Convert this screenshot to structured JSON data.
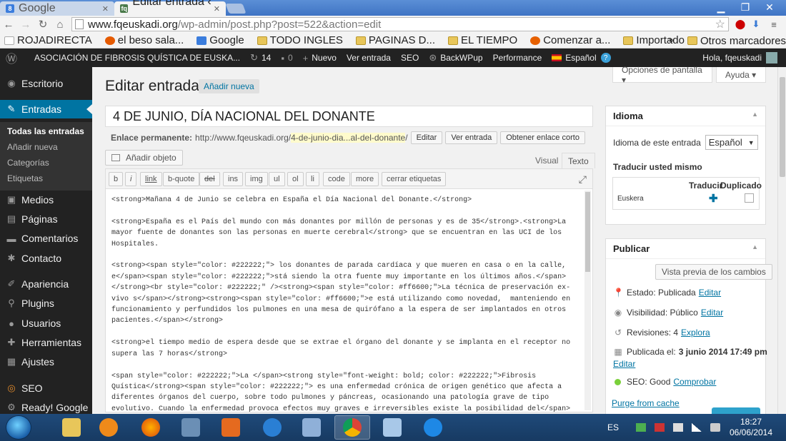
{
  "browser": {
    "tabs": [
      {
        "label": "Google",
        "active": false
      },
      {
        "label": "Editar entrada ‹ .",
        "active": true
      }
    ],
    "url_domain": "www.fqeuskadi.org",
    "url_rest": "/wp-admin/post.php?post=522&action=edit",
    "bookmarks": [
      "ROJADIRECTA",
      "el beso sala...",
      "Google",
      "TODO INGLES",
      "PAGINAS D...",
      "EL TIEMPO",
      "Comenzar a...",
      "Importado ..."
    ],
    "bookmarks_more": "»",
    "other_bookmarks": "Otros marcadores"
  },
  "adminbar": {
    "site_name": "ASOCIACIÓN DE FIBROSIS QUÍSTICA DE EUSKA...",
    "updates_count": "14",
    "comments_count": "0",
    "new_label": "Nuevo",
    "view_post": "Ver entrada",
    "seo": "SEO",
    "backwpup": "BackWPup",
    "performance": "Performance",
    "language": "Español",
    "greeting": "Hola, fqeuskadi"
  },
  "sidebar": {
    "items": [
      {
        "label": "Escritorio",
        "icon": "dashboard-icon"
      },
      {
        "label": "Entradas",
        "icon": "pin-icon"
      },
      {
        "label": "Medios",
        "icon": "media-icon"
      },
      {
        "label": "Páginas",
        "icon": "pages-icon"
      },
      {
        "label": "Comentarios",
        "icon": "comments-icon"
      },
      {
        "label": "Contacto",
        "icon": "contact-icon"
      },
      {
        "label": "Apariencia",
        "icon": "brush-icon"
      },
      {
        "label": "Plugins",
        "icon": "plugin-icon"
      },
      {
        "label": "Usuarios",
        "icon": "users-icon"
      },
      {
        "label": "Herramientas",
        "icon": "tools-icon"
      },
      {
        "label": "Ajustes",
        "icon": "settings-icon"
      },
      {
        "label": "SEO",
        "icon": "seo-icon"
      },
      {
        "label": "Ready! Google",
        "icon": "gear-icon"
      }
    ],
    "submenu": [
      "Todas las entradas",
      "Añadir nueva",
      "Categorías",
      "Etiquetas"
    ]
  },
  "main": {
    "page_title": "Editar entrada",
    "add_new": "Añadir nueva",
    "screen_options": "Opciones de pantalla ▾",
    "help": "Ayuda ▾",
    "post_title": "4 DE JUNIO, DÍA NACIONAL DEL DONANTE",
    "permalink_label": "Enlace permanente:",
    "permalink_base": "http://www.fqeuskadi.org/",
    "permalink_slug": "4-de-junio-dia...al-del-donante",
    "permalink_suffix": "/",
    "btn_edit": "Editar",
    "btn_view": "Ver entrada",
    "btn_shortlink": "Obtener enlace corto",
    "add_media": "Añadir objeto",
    "tab_visual": "Visual",
    "tab_text": "Texto",
    "quicktags": [
      "b",
      "i",
      "link",
      "b-quote",
      "del",
      "ins",
      "img",
      "ul",
      "ol",
      "li",
      "code",
      "more",
      "cerrar etiquetas"
    ],
    "content": "<strong>Mañana 4 de Junio se celebra en España el Día Nacional del Donante.</strong>\n\n<strong>España es el País del mundo con más donantes por millón de personas y es de 35</strong>.<strong>La mayor fuente de donantes son las personas en muerte cerebral</strong> que se encuentran en las UCI de los Hospitales.\n\n<strong><span style=\"color: #222222;\"> los donantes de parada cardíaca y que mueren en casa o en la calle, e</span><span style=\"color: #222222;\">stá siendo la otra fuente muy importante en los últimos años.</span></strong><br style=\"color: #222222;\" /><strong><span style=\"color: #ff6600;\">La técnica de preservación ex-vivo s</span></strong><strong><span style=\"color: #ff6600;\">e está utilizando como novedad,  manteniendo en funcionamiento y perfundidos los pulmones en una mesa de quirófano a la espera de ser implantados en otros pacientes.</span></strong>\n\n<strong>el tiempo medio de espera desde que se extrae el órgano del donante y se implanta en el receptor no supera las 7 horas</strong>\n\n<span style=\"color: #222222;\">La </span><strong style=\"font-weight: bold; color: #222222;\">Fibrosis Quística</strong><span style=\"color: #222222;\"> es una enfermedad crónica de origen genético que afecta a diferentes órganos del cuerpo, sobre todo pulmones y páncreas, ocasionando una patología grave de tipo evolutivo. Cuando la enfermedad provoca efectos muy graves e irreversibles existe la posibilidad del</span><strong style=\"font-weight: bold; color: #222222;\"> trasplante pulmonar y/o hepático.</strong><span style=\"color: #222222;\"> </span>"
  },
  "idioma_box": {
    "title": "Idioma",
    "lang_label": "Idioma de este entrada",
    "lang_value": "Español",
    "translate_label": "Traducir usted mismo",
    "col_translate": "Traducir",
    "col_duplicate": "Duplicado",
    "row_lang": "Euskera"
  },
  "publish_box": {
    "title": "Publicar",
    "preview": "Vista previa de los cambios",
    "status": "Estado: Publicada",
    "visibility": "Visibilidad: Público",
    "revisions": "Revisiones: 4",
    "explore": "Explora",
    "published_prefix": "Publicada el:",
    "published_date": "3 junio 2014 17:49 pm",
    "edit": "Editar",
    "seo_label": "SEO: Good",
    "seo_check": "Comprobar",
    "purge": "Purge from cache",
    "seo_color": "#7ad03a"
  },
  "taskbar": {
    "lang": "ES",
    "time": "18:27",
    "date": "06/06/2014"
  },
  "colors": {
    "accent": "#0074a2",
    "adminbar": "#222222",
    "slug_highlight": "#fffbcc"
  }
}
